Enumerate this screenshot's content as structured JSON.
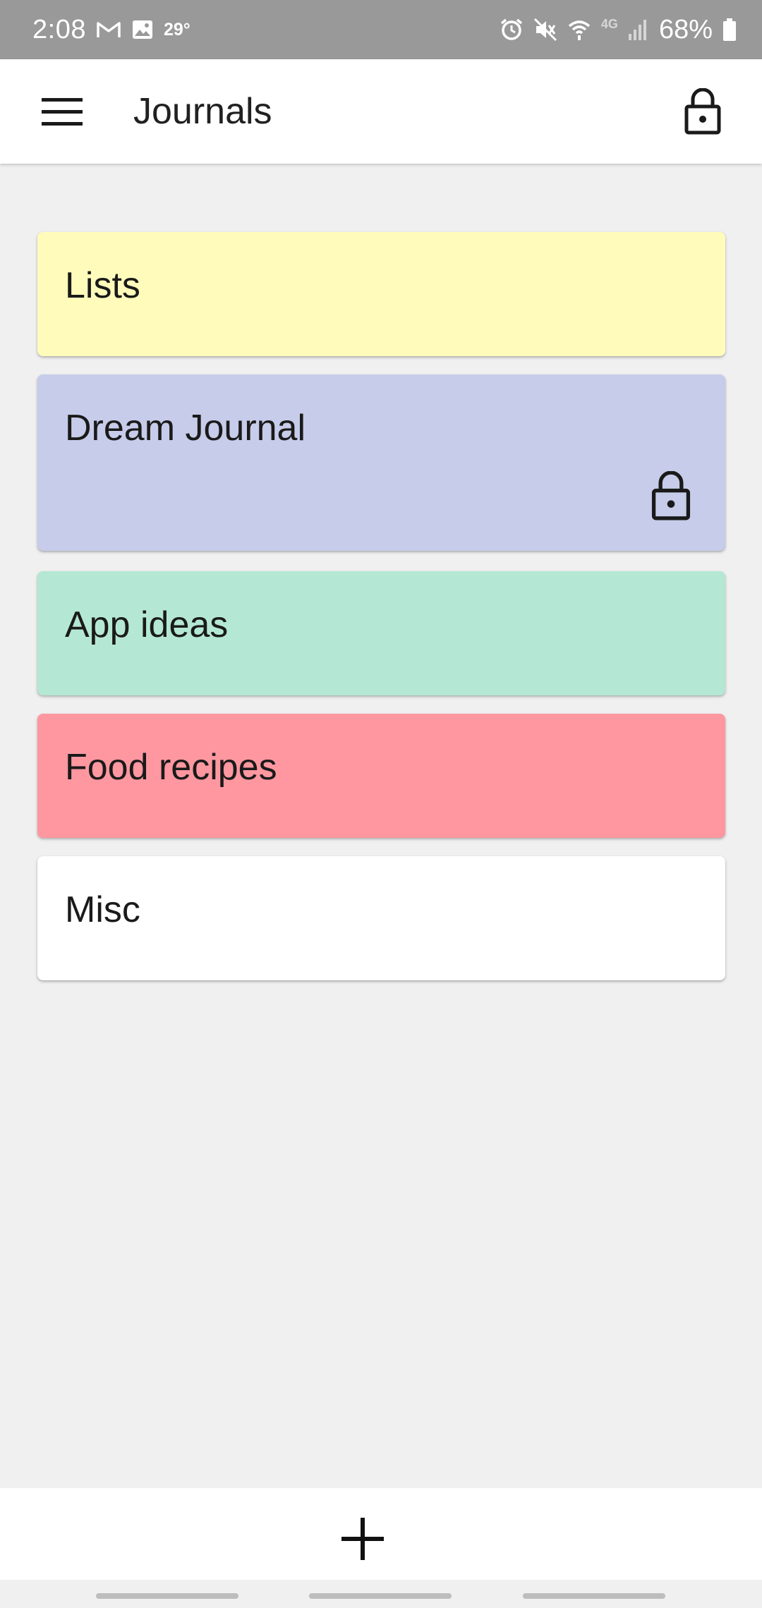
{
  "status_bar": {
    "time": "2:08",
    "temperature": "29°",
    "battery": "68%",
    "network": "4G",
    "icons": [
      "gmail-icon",
      "gallery-icon",
      "alarm-icon",
      "mute-icon",
      "wifi-icon",
      "signal-icon",
      "battery-icon"
    ]
  },
  "app_bar": {
    "title": "Journals",
    "menu_icon": "hamburger-menu-icon",
    "lock_icon": "unlocked-lock-icon"
  },
  "journals": [
    {
      "name": "Lists",
      "color": "#fffcbb",
      "locked": false
    },
    {
      "name": "Dream Journal",
      "color": "#c6cce9",
      "locked": true
    },
    {
      "name": "App ideas",
      "color": "#b4e8d4",
      "locked": false
    },
    {
      "name": "Food recipes",
      "color": "#ff97a0",
      "locked": false
    },
    {
      "name": "Misc",
      "color": "#ffffff",
      "locked": false
    }
  ],
  "bottom_bar": {
    "add_icon": "plus-icon"
  }
}
